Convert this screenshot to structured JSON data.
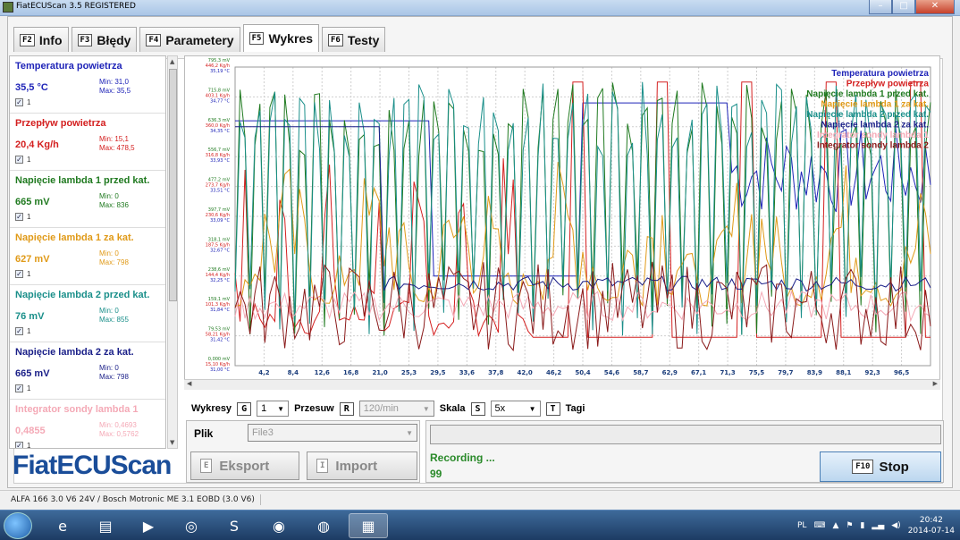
{
  "window": {
    "title": "FiatECUScan 3.5 REGISTERED",
    "btn_min": "–",
    "btn_max": "□",
    "btn_close": "✕"
  },
  "tabs": [
    {
      "key": "F2",
      "label": "Info"
    },
    {
      "key": "F3",
      "label": "Błędy"
    },
    {
      "key": "F4",
      "label": "Parametery"
    },
    {
      "key": "F5",
      "label": "Wykres"
    },
    {
      "key": "F6",
      "label": "Testy"
    }
  ],
  "sensors": [
    {
      "name": "Temperatura powietrza",
      "value": "35,5 °C",
      "min": "Min: 31,0",
      "max": "Max: 35,5",
      "idx": "1",
      "color": "#1f24b8"
    },
    {
      "name": "Przepływ powietrza",
      "value": "20,4 Kg/h",
      "min": "Min: 15,1",
      "max": "Max: 478,5",
      "idx": "1",
      "color": "#d42020"
    },
    {
      "name": "Napięcie lambda 1 przed kat.",
      "value": "665 mV",
      "min": "Min: 0",
      "max": "Max: 836",
      "idx": "1",
      "color": "#207a20"
    },
    {
      "name": "Napięcie lambda 1 za kat.",
      "value": "627 mV",
      "min": "Min: 0",
      "max": "Max: 798",
      "idx": "1",
      "color": "#e09a18"
    },
    {
      "name": "Napięcie lambda 2 przed kat.",
      "value": "76 mV",
      "min": "Min: 0",
      "max": "Max: 855",
      "idx": "1",
      "color": "#1a8f8a"
    },
    {
      "name": "Napięcie lambda 2 za kat.",
      "value": "665 mV",
      "min": "Min: 0",
      "max": "Max: 798",
      "idx": "1",
      "color": "#1a1f88"
    },
    {
      "name": "Integrator sondy lambda 1",
      "value": "0,4855",
      "min": "Min: 0,4693",
      "max": "Max: 0,5762",
      "idx": "1",
      "color": "#f4a9b6"
    }
  ],
  "chart_data": {
    "type": "line",
    "legend_position": "top-right",
    "grid": true,
    "legend": [
      {
        "name": "Temperatura powietrza",
        "color": "#1f24b8"
      },
      {
        "name": "Przepływ powietrza",
        "color": "#d42020"
      },
      {
        "name": "Napięcie lambda 1 przed kat.",
        "color": "#207a20"
      },
      {
        "name": "Napięcie lambda 1 za kat.",
        "color": "#e09a18"
      },
      {
        "name": "Napięcie lambda 2 przed kat.",
        "color": "#1a8f8a"
      },
      {
        "name": "Napięcie lambda 2 za kat.",
        "color": "#1a1f88"
      },
      {
        "name": "Integrator sondy lambda 1",
        "color": "#f4a9b6"
      },
      {
        "name": "Integrator sondy lambda 2",
        "color": "#8a1a1a"
      }
    ],
    "x_ticks": [
      "4,2",
      "8,4",
      "12,6",
      "16,8",
      "21,0",
      "25,3",
      "29,5",
      "33,6",
      "37,8",
      "42,0",
      "46,2",
      "50,4",
      "54,6",
      "58,7",
      "62,9",
      "67,1",
      "71,3",
      "75,5",
      "79,7",
      "83,9",
      "88,1",
      "92,3",
      "96,5"
    ],
    "y_ticks": [
      [
        "795,3 mV",
        "446,2 Kg/h",
        "35,19 °C"
      ],
      [
        "715,8 mV",
        "403,1 Kg/h",
        "34,77 °C"
      ],
      [
        "636,3 mV",
        "360,0 Kg/h",
        "34,35 °C"
      ],
      [
        "556,7 mV",
        "316,8 Kg/h",
        "33,93 °C"
      ],
      [
        "477,2 mV",
        "273,7 Kg/h",
        "33,51 °C"
      ],
      [
        "397,7 mV",
        "230,6 Kg/h",
        "33,09 °C"
      ],
      [
        "318,1 mV",
        "187,5 Kg/h",
        "32,67 °C"
      ],
      [
        "238,6 mV",
        "144,4 Kg/h",
        "32,25 °C"
      ],
      [
        "159,1 mV",
        "101,3 Kg/h",
        "31,84 °C"
      ],
      [
        "79,53 mV",
        "58,21 Kg/h",
        "31,42 °C"
      ],
      [
        "0,000 mV",
        "15,10 Kg/h",
        "31,00 °C"
      ]
    ]
  },
  "controls": {
    "wykresy_label": "Wykresy",
    "wykresy_key": "G",
    "wykresy_value": "1",
    "przesuw_label": "Przesuw",
    "przesuw_key": "R",
    "przesuw_value": "120/min",
    "skala_label": "Skala",
    "skala_key": "S",
    "skala_value": "5x",
    "tagi_key": "T",
    "tagi_label": "Tagi"
  },
  "file": {
    "label": "Plik",
    "value": "File3",
    "export_key": "E",
    "export_label": "Eksport",
    "import_key": "I",
    "import_label": "Import"
  },
  "recording": {
    "status": "Recording ...",
    "count": "99",
    "stop_key": "F10",
    "stop_label": "Stop"
  },
  "logo": "FiatECUScan",
  "statusbar": {
    "text": "ALFA 166 3.0 V6 24V / Bosch Motronic ME 3.1 EOBD (3.0 V6)"
  },
  "tray": {
    "lang": "PL",
    "time": "20:42",
    "date": "2014-07-14"
  }
}
